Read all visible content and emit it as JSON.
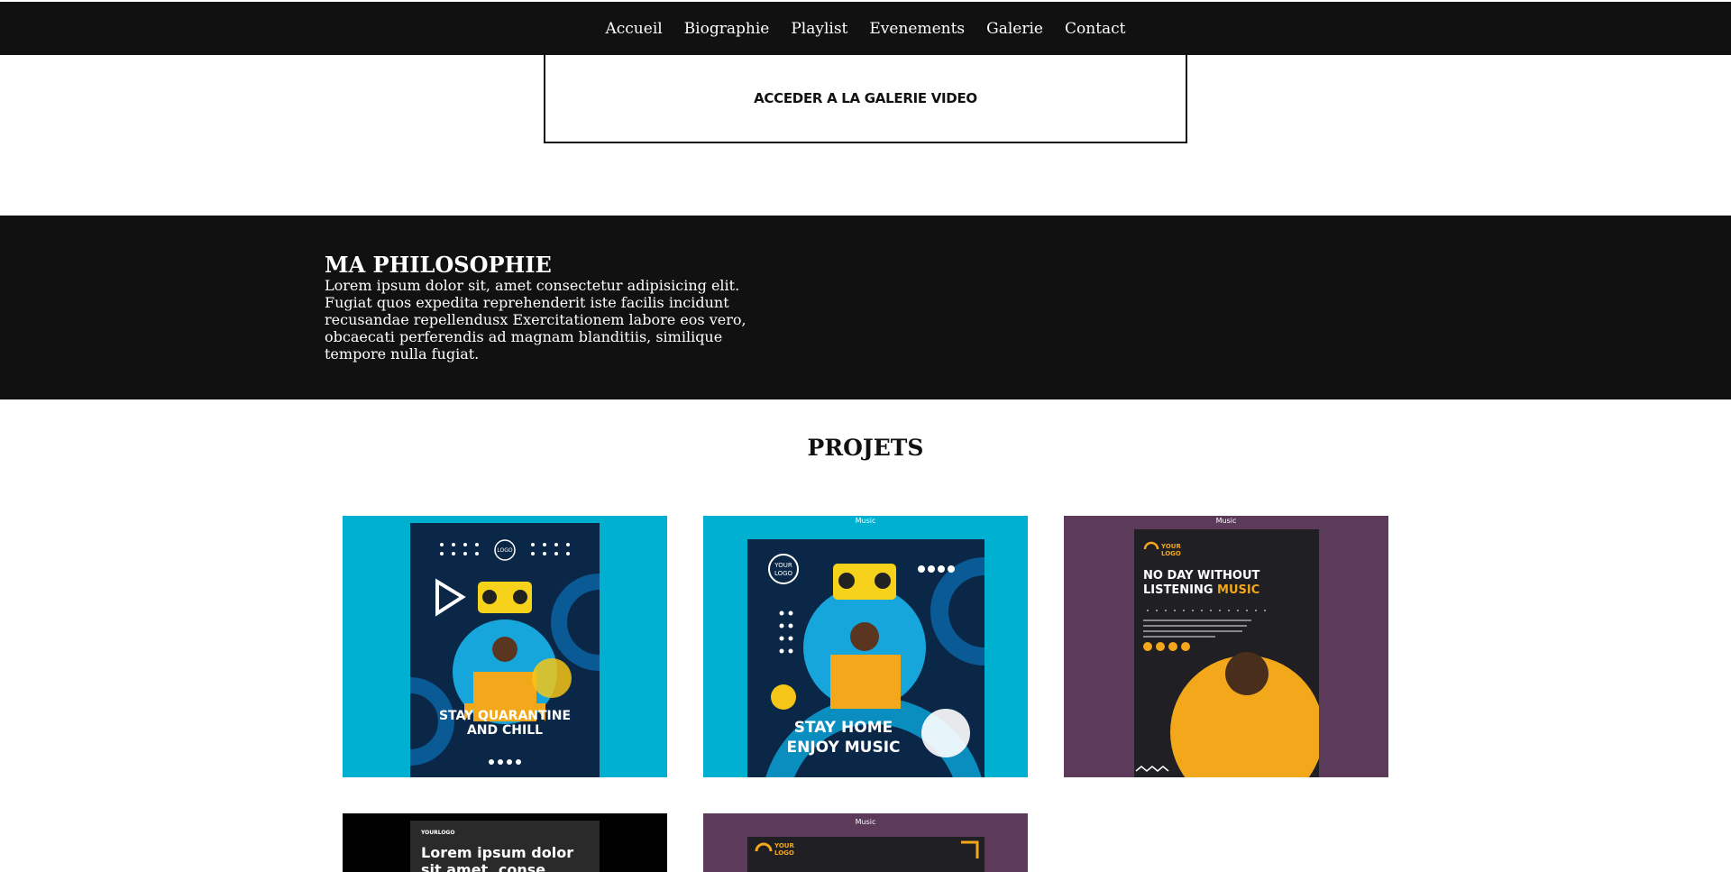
{
  "nav": {
    "items": [
      {
        "label": "Accueil"
      },
      {
        "label": "Biographie"
      },
      {
        "label": "Playlist"
      },
      {
        "label": "Evenements"
      },
      {
        "label": "Galerie"
      },
      {
        "label": "Contact"
      }
    ]
  },
  "video_gallery": {
    "label": "ACCEDER A LA GALERIE VIDEO"
  },
  "philosophy": {
    "title": "MA PHILOSOPHIE",
    "text": "Lorem ipsum dolor sit, amet consectetur adipisicing elit. Fugiat quos expedita reprehenderit iste facilis incidunt recusandae repellendusx Exercitationem labore eos vero, obcaecati perferendis ad magnam blanditiis, similique tempore nulla fugiat."
  },
  "projects": {
    "title": "PROJETS",
    "items": [
      {
        "line1": "STAY QUARANTINE",
        "line2": "AND CHILL",
        "logo": "YOUR LOGO",
        "bg": "#00b0d0"
      },
      {
        "caption": "Music",
        "line1": "STAY HOME",
        "line2": "ENJOY MUSIC",
        "logo": "YOUR LOGO",
        "bg": "#00b0d0"
      },
      {
        "caption": "Music",
        "line1": "NO DAY WITHOUT",
        "line2": "LISTENING",
        "line2b": "MUSIC",
        "logo": "YOUR LOGO",
        "bg": "#5b3a5a"
      },
      {
        "line1": "Lorem ipsum dolor",
        "line2": "sit amet, conse",
        "logo": "YOURLOGO",
        "bg": "#000000"
      },
      {
        "caption": "Music",
        "logo": "YOUR LOGO",
        "bg": "#5b3a5a"
      }
    ]
  },
  "colors": {
    "dark": "#111111",
    "cyan": "#00b0d0",
    "purple": "#5b3a5a",
    "accent_yellow": "#f5c518"
  }
}
